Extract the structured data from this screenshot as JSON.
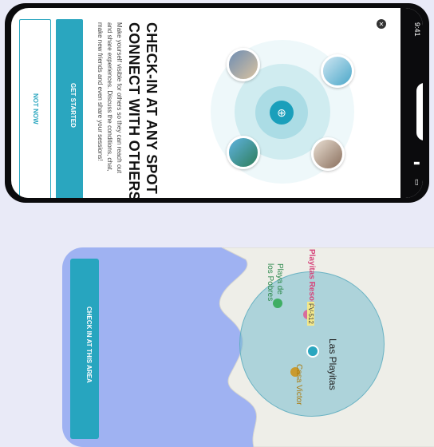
{
  "top_phone": {
    "status": {
      "time": "9:41",
      "signal": "signal-icon",
      "wifi": "wifi-icon",
      "battery": "battery-icon"
    },
    "close_icon": "close-icon",
    "title_line1": "CHECK-IN AT ANY SPOT",
    "title_line2": "CONNECT WITH OTHERS",
    "body_lines": [
      "Make yourself visible for others so they can reach out",
      "and share experiences. Discuss the conditions, chat,",
      "make new friends and even share your sessions!"
    ],
    "primary_button": "GET STARTED",
    "secondary_button": "NOT NOW",
    "center_icon": "location-plus-icon"
  },
  "bottom_phone": {
    "map_labels": {
      "playitas_resort": "Playitas Resort",
      "playa_line1": "Playa de",
      "playa_line2": "los Pobres",
      "las_playitas": "Las Playitas",
      "casa_victor": "Casa Victor",
      "road": "FV-512"
    },
    "action_button": "CHECK IN AT THIS AREA"
  },
  "colors": {
    "accent": "#2aa6bf",
    "sea": "#9fb2f2",
    "background": "#e9eaf7"
  }
}
